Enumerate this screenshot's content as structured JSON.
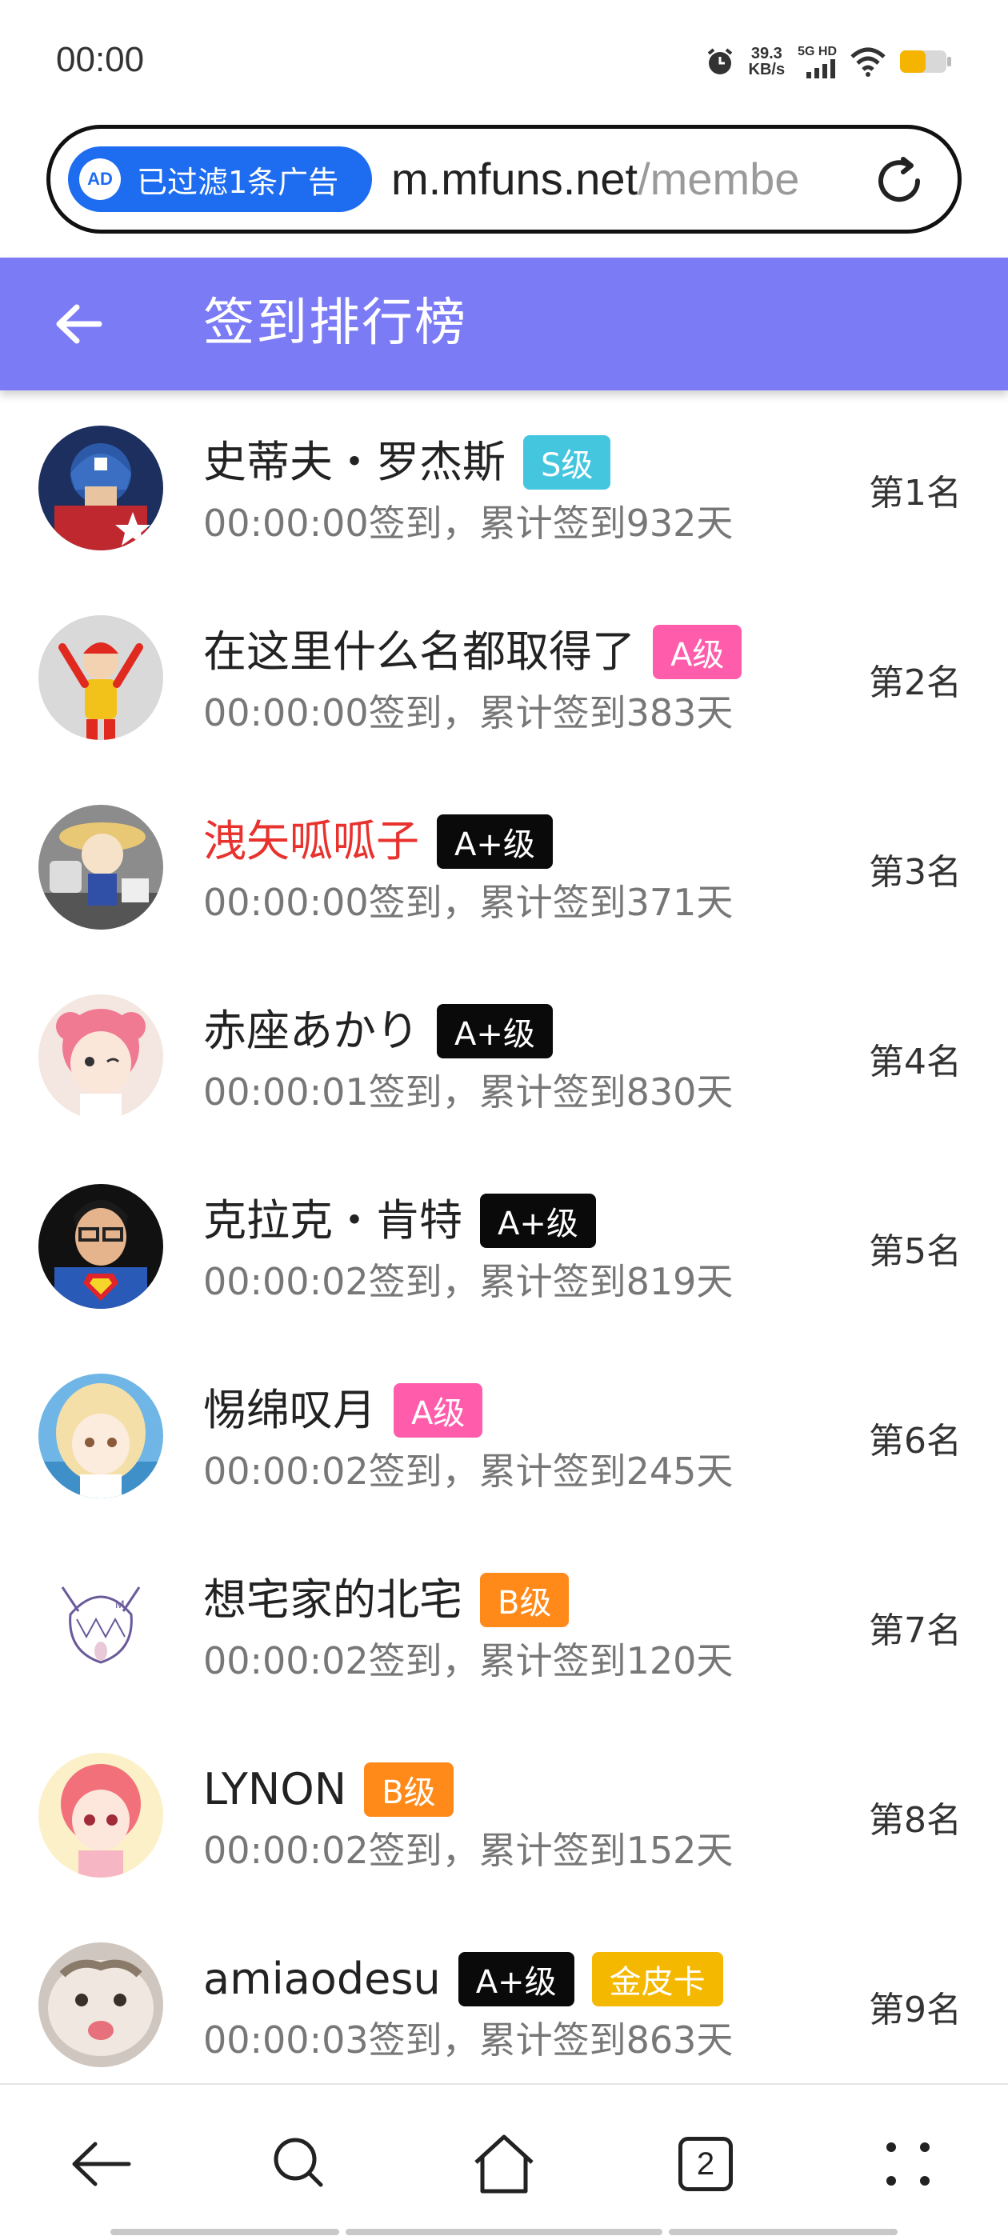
{
  "status_bar": {
    "time": "00:00",
    "net_speed_value": "39.3",
    "net_speed_unit": "KB/s",
    "net_type": "5G HD"
  },
  "url_bar": {
    "ad_badge_text": "已过滤1条广告",
    "ad_icon_text": "AD",
    "url_host": "m.mfuns.net",
    "url_path": "/membe"
  },
  "header": {
    "title": "签到排行榜"
  },
  "colors": {
    "header_bg": "#7b7bf6",
    "ad_pill": "#1e6cf0",
    "badge_s": "#44c6df",
    "badge_a": "#ff5cac",
    "badge_aplus": "#0a0a0a",
    "badge_b": "#ff8a1a",
    "badge_gold": "#f5b800",
    "highlight_name": "#e8322e"
  },
  "ranking": [
    {
      "name": "史蒂夫・罗杰斯",
      "badges": [
        "S级"
      ],
      "sign_info": "00:00:00签到，累计签到932天",
      "rank": "第1名",
      "avatar": "captain-america-avatar"
    },
    {
      "name": "在这里什么名都取得了",
      "badges": [
        "A级"
      ],
      "sign_info": "00:00:00签到，累计签到383天",
      "rank": "第2名",
      "avatar": "clown-avatar"
    },
    {
      "name": "洩矢呱呱子",
      "badges": [
        "A+级"
      ],
      "sign_info": "00:00:00签到，累计签到371天",
      "rank": "第3名",
      "avatar": "figure-avatar"
    },
    {
      "name": "赤座あかり",
      "badges": [
        "A+级"
      ],
      "sign_info": "00:00:01签到，累计签到830天",
      "rank": "第4名",
      "avatar": "anime-pink-avatar"
    },
    {
      "name": "克拉克・肯特",
      "badges": [
        "A+级"
      ],
      "sign_info": "00:00:02签到，累计签到819天",
      "rank": "第5名",
      "avatar": "superman-avatar"
    },
    {
      "name": "惕绵叹月",
      "badges": [
        "A级"
      ],
      "sign_info": "00:00:02签到，累计签到245天",
      "rank": "第6名",
      "avatar": "anime-blonde-avatar"
    },
    {
      "name": "想宅家的北宅",
      "badges": [
        "B级"
      ],
      "sign_info": "00:00:02签到，累计签到120天",
      "rank": "第7名",
      "avatar": "sketch-avatar"
    },
    {
      "name": "LYNON",
      "badges": [
        "B级"
      ],
      "sign_info": "00:00:02签到，累计签到152天",
      "rank": "第8名",
      "avatar": "anime-red-avatar"
    },
    {
      "name": "amiaodesu",
      "badges": [
        "A+级",
        "金皮卡"
      ],
      "sign_info": "00:00:03签到，累计签到863天",
      "rank": "第9名",
      "avatar": "cat-avatar"
    }
  ],
  "bottom_nav": {
    "tab_count": "2"
  }
}
